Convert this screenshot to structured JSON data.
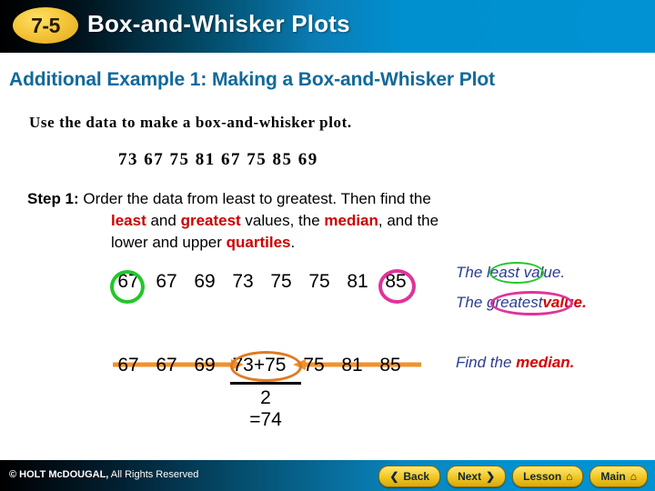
{
  "header": {
    "badge": "7-5",
    "title": "Box-and-Whisker Plots"
  },
  "subtitle": "Additional Example 1: Making a Box-and-Whisker Plot",
  "content": {
    "prompt": "Use the data to make a box-and-whisker plot.",
    "raw_data": "73  67  75  81  67  75  85  69",
    "step": {
      "label": "Step 1:",
      "line1": " Order the data from least to greatest. Then find the",
      "line2_a": "least",
      "line2_b": " and ",
      "line2_c": "greatest",
      "line2_d": " values, the ",
      "line2_e": "median",
      "line2_f": ", and the",
      "line3_a": "lower and upper ",
      "line3_b": "quartiles",
      "line3_c": "."
    },
    "ordered_values": [
      "67",
      "67",
      "69",
      "73",
      "75",
      "75",
      "81",
      "85"
    ],
    "median_row": {
      "left_values": [
        "67",
        "67",
        "69"
      ],
      "numerator": "73+75",
      "right_values": [
        "75",
        "81",
        "85"
      ],
      "denominator": "2",
      "result": "=74"
    },
    "annotations": {
      "least_pre": "The ",
      "least_word": "least",
      "least_post": " value.",
      "greatest_pre": "The ",
      "greatest_word": "greatest",
      "greatest_post": "value.",
      "median_pre": "Find the ",
      "median_word": "median."
    }
  },
  "footer": {
    "copyright_bold": "© HOLT McDOUGAL,",
    "copyright_light": " All Rights Reserved",
    "buttons": [
      {
        "label": "Back",
        "icon": "chevron-left-icon",
        "glyph": "❮"
      },
      {
        "label": "Next",
        "icon": "chevron-right-icon",
        "glyph": "❯"
      },
      {
        "label": "Lesson",
        "icon": "home-icon",
        "glyph": "⌂"
      },
      {
        "label": "Main",
        "icon": "home-icon",
        "glyph": "⌂"
      }
    ]
  },
  "colors": {
    "header_blue": "#0092d2",
    "subtitle_teal": "#10699b",
    "accent_red": "#cc0000",
    "circle_green": "#22c72a",
    "circle_pink": "#e0339a",
    "circle_orange": "#e07a1f",
    "anno_blue": "#2b3c8f",
    "badge_gold": "#f5c63a"
  }
}
